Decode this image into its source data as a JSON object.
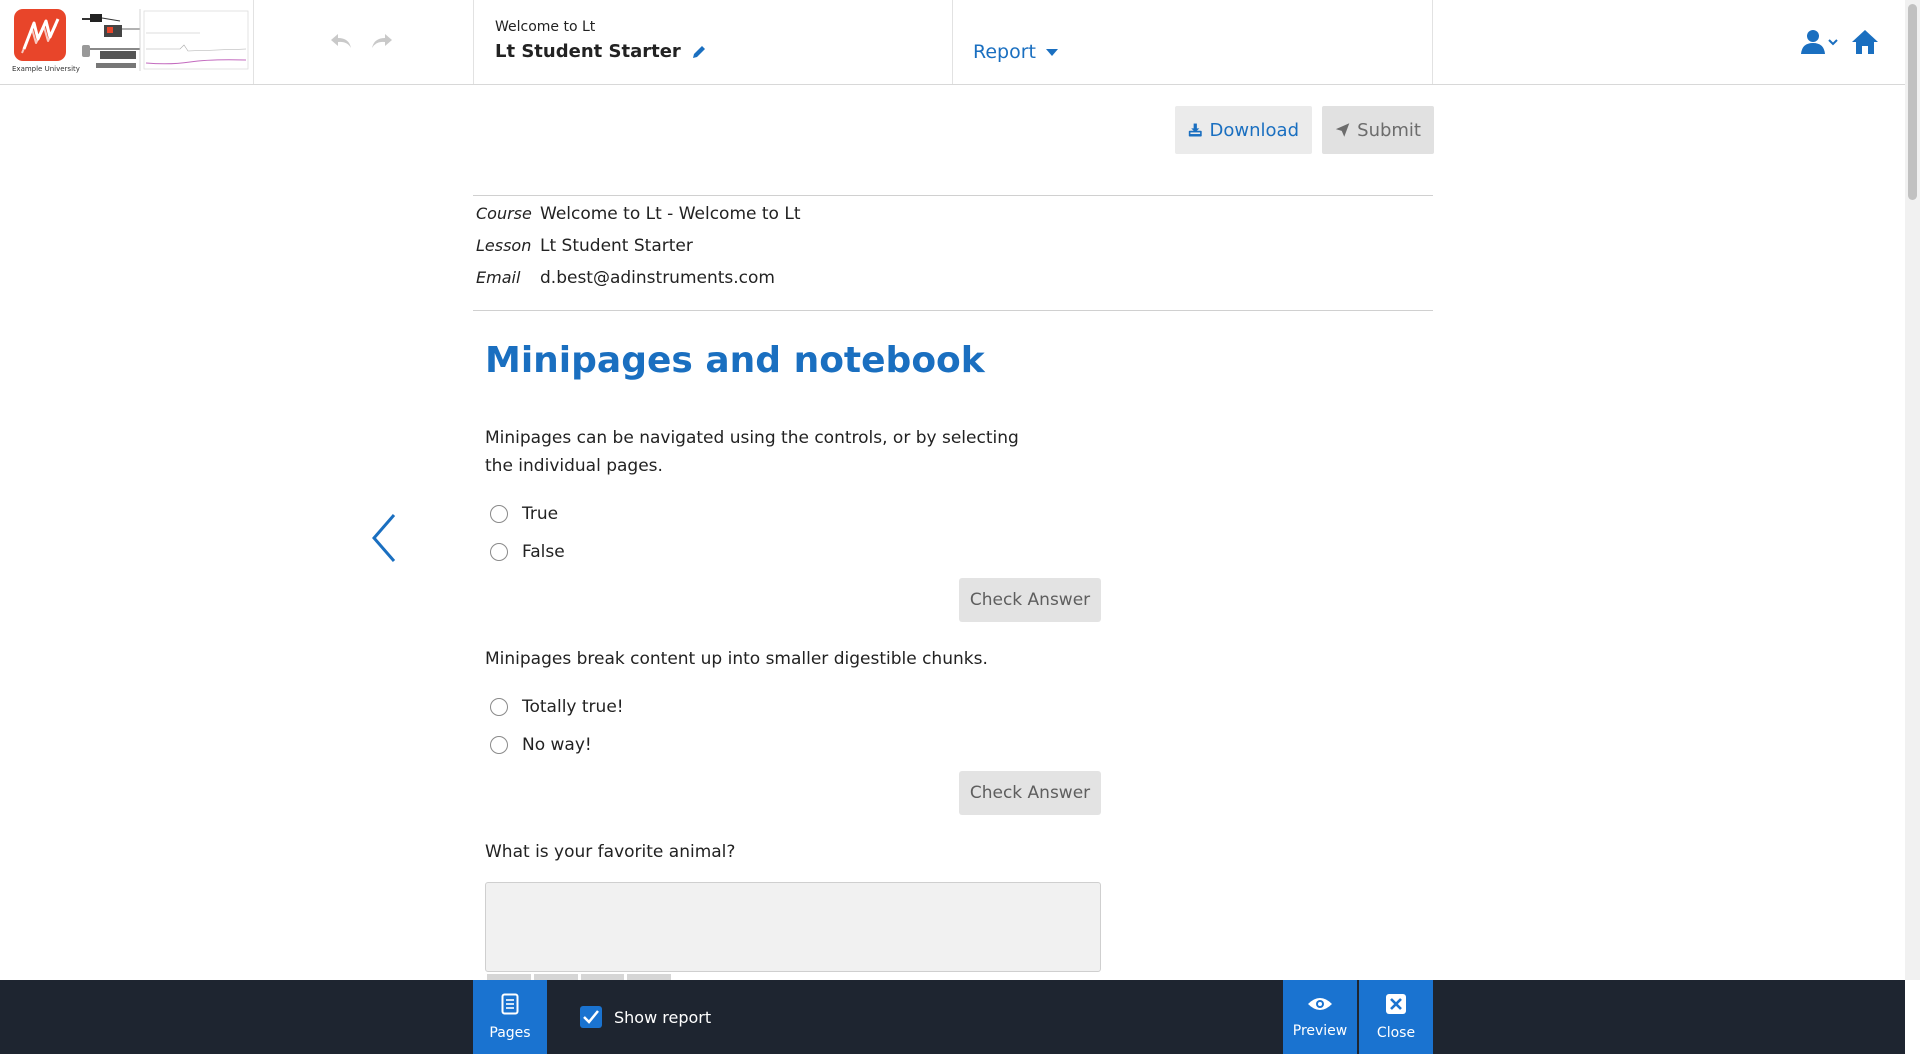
{
  "logo": {
    "caption": "Example University"
  },
  "header": {
    "subtitle": "Welcome to Lt",
    "title": "Lt Student Starter",
    "report_label": "Report"
  },
  "actions": {
    "download_label": "Download",
    "submit_label": "Submit"
  },
  "meta": [
    {
      "key": "Course",
      "value": "Welcome to Lt - Welcome to Lt"
    },
    {
      "key": "Lesson",
      "value": "Lt Student Starter"
    },
    {
      "key": "Email",
      "value": "d.best@adinstruments.com"
    }
  ],
  "page": {
    "heading": "Minipages and notebook",
    "questions": [
      {
        "text": "Minipages can be navigated using the controls, or by selecting the individual pages.",
        "options": [
          "True",
          "False"
        ],
        "check_label": "Check Answer"
      },
      {
        "text": "Minipages break content up into smaller digestible chunks.",
        "options": [
          "Totally true!",
          "No way!"
        ],
        "check_label": "Check Answer"
      },
      {
        "text": "What is your favorite animal?",
        "answer_value": ""
      }
    ]
  },
  "bottombar": {
    "pages_label": "Pages",
    "show_report_label": "Show report",
    "show_report_checked": true,
    "preview_label": "Preview",
    "close_label": "Close"
  },
  "colors": {
    "accent": "#1a6fc0",
    "bottombar": "#1e2530",
    "bottom_button": "#1a73d0",
    "logo": "#e8452a"
  }
}
